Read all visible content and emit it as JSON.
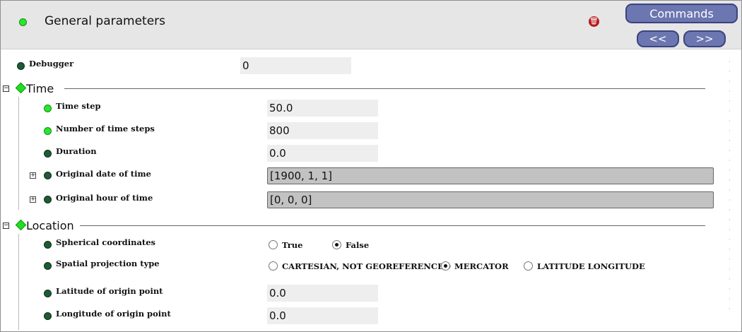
{
  "header": {
    "title": "General parameters",
    "commands_label": "Commands",
    "prev_label": "<<",
    "next_label": ">>"
  },
  "debugger": {
    "label": "Debugger",
    "value": "0"
  },
  "time": {
    "section_label": "Time",
    "time_step": {
      "label": "Time step",
      "value": "50.0"
    },
    "num_steps": {
      "label": "Number of time steps",
      "value": "800"
    },
    "duration": {
      "label": "Duration",
      "value": "0.0"
    },
    "orig_date": {
      "label": "Original date of time",
      "value": "[1900, 1, 1]"
    },
    "orig_hour": {
      "label": "Original hour of time",
      "value": "[0, 0, 0]"
    }
  },
  "location": {
    "section_label": "Location",
    "spherical": {
      "label": "Spherical coordinates",
      "options": [
        "True",
        "False"
      ],
      "selected": "False"
    },
    "projection": {
      "label": "Spatial projection type",
      "options": [
        "CARTESIAN, NOT GEOREFERENCED",
        "MERCATOR",
        "LATITUDE LONGITUDE"
      ],
      "selected": "MERCATOR"
    },
    "lat_origin": {
      "label": "Latitude of origin point",
      "value": "0.0"
    },
    "lon_origin": {
      "label": "Longitude of origin point",
      "value": "0.0"
    }
  },
  "colors": {
    "accent_button": "#6c76b0",
    "status_green": "#27e82a",
    "status_dark": "#1f5a35"
  }
}
